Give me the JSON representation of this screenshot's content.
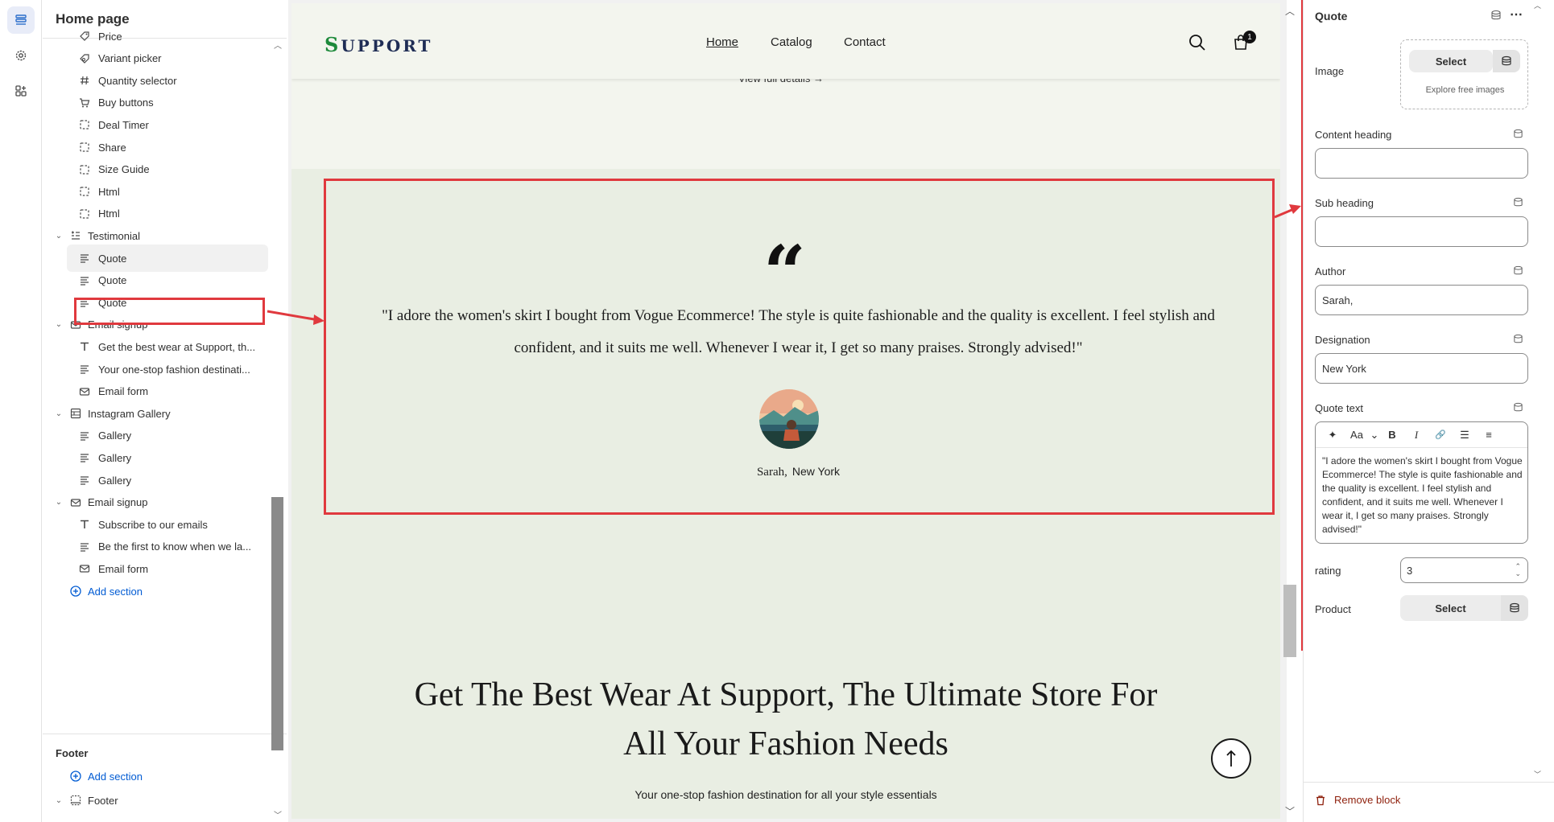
{
  "sidebar": {
    "title": "Home page",
    "items": [
      {
        "label": "Price",
        "icon": "price-icon"
      },
      {
        "label": "Variant picker",
        "icon": "variant-icon"
      },
      {
        "label": "Quantity selector",
        "icon": "hash-icon"
      },
      {
        "label": "Buy buttons",
        "icon": "cart-icon"
      },
      {
        "label": "Deal Timer",
        "icon": "block-icon"
      },
      {
        "label": "Share",
        "icon": "block-icon"
      },
      {
        "label": "Size Guide",
        "icon": "block-icon"
      },
      {
        "label": "Html",
        "icon": "block-icon"
      },
      {
        "label": "Html",
        "icon": "block-icon"
      },
      {
        "label": "Testimonial",
        "icon": "section-icon"
      },
      {
        "label": "Quote",
        "icon": "text-lines-icon"
      },
      {
        "label": "Quote",
        "icon": "text-lines-icon"
      },
      {
        "label": "Quote",
        "icon": "text-lines-icon"
      },
      {
        "label": "Email signup",
        "icon": "mail-icon"
      },
      {
        "label": "Get the best wear at Support, th...",
        "icon": "type-icon"
      },
      {
        "label": "Your one-stop fashion destinati...",
        "icon": "text-lines-icon"
      },
      {
        "label": "Email form",
        "icon": "mail-icon"
      },
      {
        "label": "Instagram Gallery",
        "icon": "gallery-icon"
      },
      {
        "label": "Gallery",
        "icon": "text-lines-icon"
      },
      {
        "label": "Gallery",
        "icon": "text-lines-icon"
      },
      {
        "label": "Gallery",
        "icon": "text-lines-icon"
      },
      {
        "label": "Email signup",
        "icon": "mail-icon"
      },
      {
        "label": "Subscribe to our emails",
        "icon": "type-icon"
      },
      {
        "label": "Be the first to know when we la...",
        "icon": "text-lines-icon"
      },
      {
        "label": "Email form",
        "icon": "mail-icon"
      }
    ],
    "add_section": "Add section",
    "footer_heading": "Footer",
    "footer_add_section": "Add section",
    "footer_item": "Footer"
  },
  "preview": {
    "logo": "SUPPORT",
    "logo_first": "S",
    "logo_rest": "UPPORT",
    "nav": [
      "Home",
      "Catalog",
      "Contact"
    ],
    "cart_count": "1",
    "view_full": "View full details  →",
    "quote_mark": "“",
    "quote_text": "\"I adore the women's skirt I bought from Vogue Ecommerce! The style is quite fashionable and the quality is excellent. I feel stylish and confident, and it suits me well. Whenever I wear it, I get so many praises. Strongly advised!\"",
    "author": "Sarah,",
    "designation": "New York",
    "heading": "Get The Best Wear At Support, The Ultimate Store For All Your Fashion Needs",
    "subtext": "Your one-stop fashion destination for all your style essentials"
  },
  "panel": {
    "title": "Quote",
    "image_label": "Image",
    "select": "Select",
    "explore": "Explore free images",
    "content_heading_label": "Content heading",
    "content_heading_value": "",
    "sub_heading_label": "Sub heading",
    "sub_heading_value": "",
    "author_label": "Author",
    "author_value": "Sarah,",
    "designation_label": "Designation",
    "designation_value": "New York",
    "quote_text_label": "Quote text",
    "quote_text_value": "\"I adore the women's skirt I bought from Vogue Ecommerce! The style is quite fashionable and the quality is excellent. I feel stylish and confident, and it suits me well. Whenever I wear it, I get so many praises. Strongly advised!\"",
    "rte_tools": [
      "✦",
      "Aa",
      "⌄",
      "B",
      "I",
      "🔗",
      "☰",
      "≡"
    ],
    "rating_label": "rating",
    "rating_value": "3",
    "product_label": "Product",
    "product_select": "Select",
    "remove_block": "Remove block"
  },
  "colors": {
    "annotation_red": "#e0393e",
    "accent_blue": "#005bd3",
    "preview_bg": "#e9eee3",
    "remove_red": "#8e1f0b"
  }
}
